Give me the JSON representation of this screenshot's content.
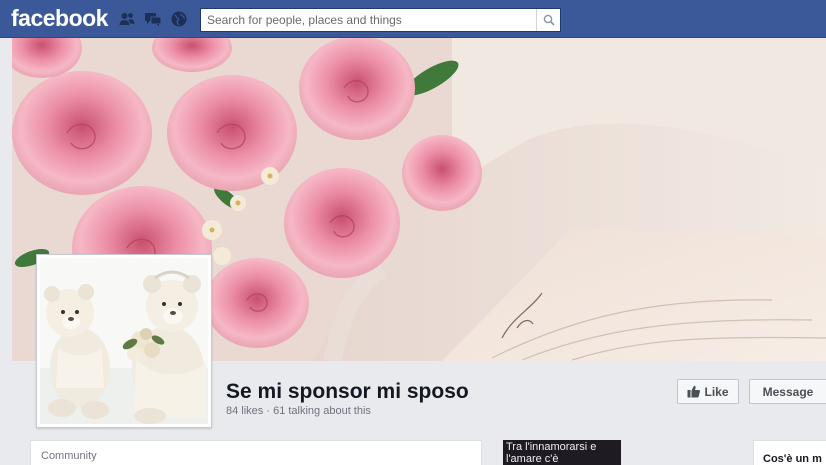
{
  "topbar": {
    "logo": "facebook",
    "search": {
      "placeholder": "Search for people, places and things"
    },
    "jewels": [
      "friend-requests-icon",
      "messages-icon",
      "notifications-globe-icon"
    ]
  },
  "page": {
    "name": "Se mi sponsor mi sposo",
    "stats": "84 likes · 61 talking about this",
    "like_label": "Like",
    "message_label": "Message"
  },
  "bottom": {
    "category": "Community",
    "thumb_caption": "Tra l'innamorarsi e l'amare c'è",
    "about_title": "Cos'è un m"
  },
  "colors": {
    "brand": "#3b5998",
    "background": "#e9eaed"
  }
}
